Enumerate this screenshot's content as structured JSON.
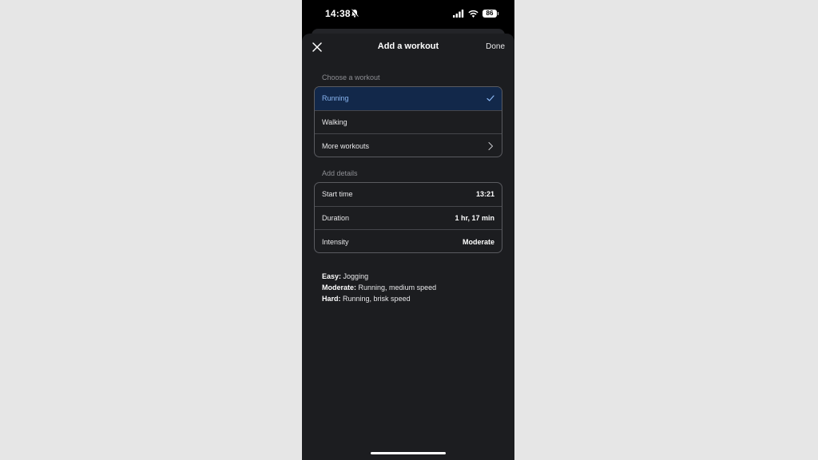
{
  "status_bar": {
    "time": "14:38",
    "battery": "86",
    "icons": [
      "bell-slash-icon",
      "cellular-signal-icon",
      "wifi-icon",
      "battery-icon"
    ]
  },
  "header": {
    "title": "Add a workout",
    "done_label": "Done",
    "close_icon": "close-icon"
  },
  "workout_section": {
    "label": "Choose a workout",
    "items": [
      {
        "label": "Running",
        "selected": true,
        "icon": "checkmark-icon"
      },
      {
        "label": "Walking",
        "selected": false
      },
      {
        "label": "More workouts",
        "selected": false,
        "icon": "chevron-right-icon"
      }
    ]
  },
  "details_section": {
    "label": "Add details",
    "rows": [
      {
        "label": "Start time",
        "value": "13:21"
      },
      {
        "label": "Duration",
        "value": "1 hr, 17 min"
      },
      {
        "label": "Intensity",
        "value": "Moderate"
      }
    ]
  },
  "intensity_notes": [
    {
      "level": "Easy:",
      "text": "Jogging"
    },
    {
      "level": "Moderate:",
      "text": "Running, medium speed"
    },
    {
      "level": "Hard:",
      "text": "Running, brisk speed"
    }
  ],
  "colors": {
    "background": "#e6e6e6",
    "sheet": "#1c1d20",
    "selected_row": "#12284a",
    "selected_text": "#8ab6f2",
    "border": "#5a5b60"
  }
}
